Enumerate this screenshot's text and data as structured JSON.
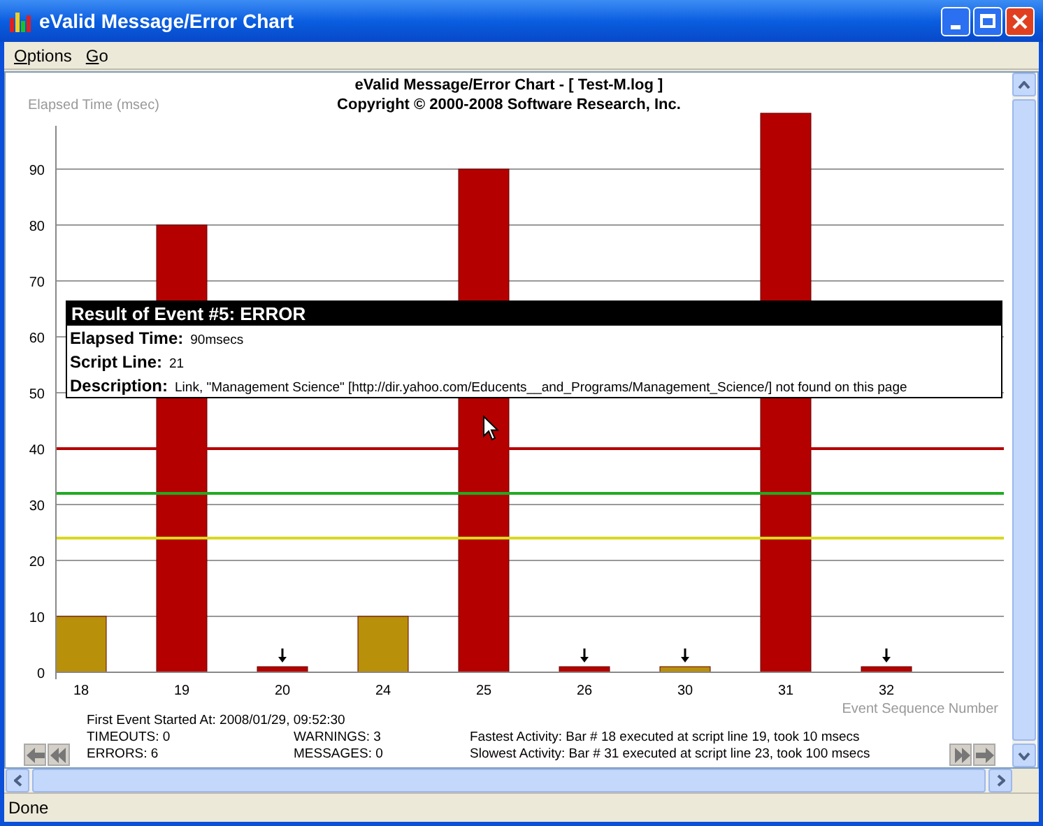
{
  "window": {
    "title": "eValid Message/Error Chart"
  },
  "menu": [
    {
      "label": "Options"
    },
    {
      "label": "Go"
    }
  ],
  "chart": {
    "heading": "eValid Message/Error Chart - [ Test-M.log ]",
    "copyright": "Copyright © 2000-2008 Software Research, Inc.",
    "chart_data": {
      "type": "bar",
      "ylabel": "Elapsed Time (msec)",
      "xlabel": "Event Sequence Number",
      "categories": [
        "18",
        "19",
        "20",
        "24",
        "25",
        "26",
        "30",
        "31",
        "32"
      ],
      "series": [
        {
          "color": "#b50000",
          "values": [
            null,
            80,
            1,
            null,
            90,
            1,
            null,
            100,
            1
          ]
        },
        {
          "color": "#b8900a",
          "values": [
            10,
            null,
            null,
            10,
            null,
            null,
            1,
            null,
            null
          ]
        }
      ],
      "ylim": [
        0,
        100
      ],
      "yticks": [
        0,
        10,
        20,
        30,
        40,
        50,
        60,
        70,
        80,
        90
      ],
      "grid": true,
      "ref_lines": [
        {
          "axis": "y",
          "value": 40,
          "color": "#b50000"
        },
        {
          "axis": "y",
          "value": 32,
          "color": "#22aa22"
        },
        {
          "axis": "y",
          "value": 24,
          "color": "#d8d820"
        }
      ]
    },
    "arrow_marks": [
      false,
      false,
      true,
      false,
      false,
      true,
      true,
      false,
      true
    ],
    "tooltip": {
      "title": "Result of Event #5: ERROR",
      "rows": [
        {
          "label": "Elapsed Time:",
          "value": "90msecs"
        },
        {
          "label": "Script Line:",
          "value": "21"
        },
        {
          "label": "Description:",
          "value": "Link, \"Management Science\" [http://dir.yahoo.com/Educents__and_Programs/Management_Science/] not found on this page"
        }
      ]
    }
  },
  "summary": {
    "first_event": "First Event Started At: 2008/01/29, 09:52:30",
    "stats": [
      "TIMEOUTS: 0",
      "WARNINGS: 3",
      "ERRORS: 6",
      "MESSAGES: 0"
    ],
    "fastest": "Fastest Activity: Bar # 18 executed at script line 19, took 10 msecs",
    "slowest": "Slowest Activity: Bar # 31 executed at script line 23, took 100 msecs"
  },
  "status_bar": {
    "text": "Done"
  }
}
